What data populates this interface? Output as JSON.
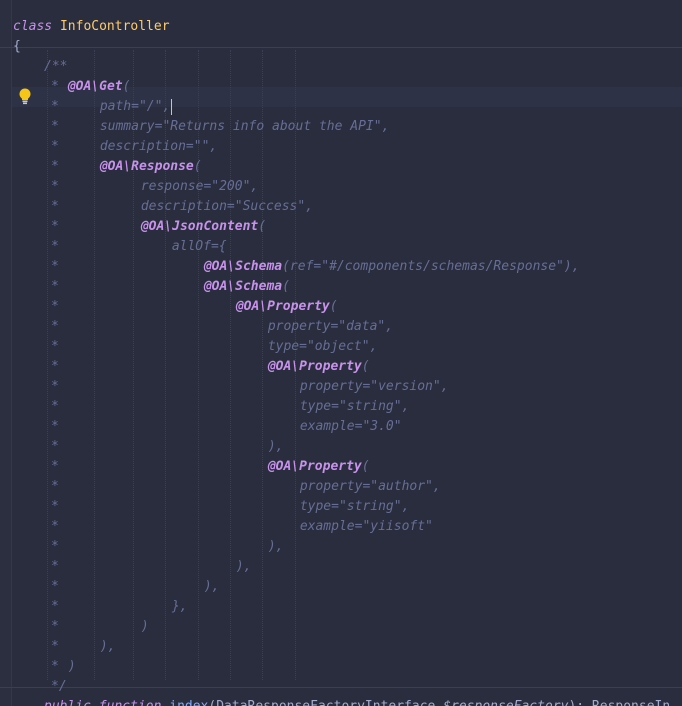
{
  "editor": {
    "header_lines": [
      {
        "kw": "class",
        "name": "InfoController"
      },
      {
        "brace": "{"
      }
    ],
    "doc_lines": [
      {
        "indent": 0,
        "text": "/**"
      },
      {
        "indent": 0,
        "star": "*",
        "ann": "@OA\\Get",
        "rest": "("
      },
      {
        "indent": 1,
        "star": "*",
        "rest": "path=\"/\","
      },
      {
        "indent": 1,
        "star": "*",
        "rest": "summary=\"Returns info about the API\","
      },
      {
        "indent": 1,
        "star": "*",
        "rest": "description=\"\","
      },
      {
        "indent": 1,
        "star": "*",
        "ann": "@OA\\Response",
        "rest": "("
      },
      {
        "indent": 2,
        "star": "*",
        "rest": "response=\"200\","
      },
      {
        "indent": 2,
        "star": "*",
        "rest": "description=\"Success\","
      },
      {
        "indent": 2,
        "star": "*",
        "ann": "@OA\\JsonContent",
        "rest": "("
      },
      {
        "indent": 3,
        "star": "*",
        "rest": "allOf={"
      },
      {
        "indent": 4,
        "star": "*",
        "ann": "@OA\\Schema",
        "rest": "(ref=\"#/components/schemas/Response\"),"
      },
      {
        "indent": 4,
        "star": "*",
        "ann": "@OA\\Schema",
        "rest": "("
      },
      {
        "indent": 5,
        "star": "*",
        "ann": "@OA\\Property",
        "rest": "("
      },
      {
        "indent": 6,
        "star": "*",
        "rest": "property=\"data\","
      },
      {
        "indent": 6,
        "star": "*",
        "rest": "type=\"object\","
      },
      {
        "indent": 6,
        "star": "*",
        "ann": "@OA\\Property",
        "rest": "("
      },
      {
        "indent": 7,
        "star": "*",
        "rest": "property=\"version\","
      },
      {
        "indent": 7,
        "star": "*",
        "rest": "type=\"string\","
      },
      {
        "indent": 7,
        "star": "*",
        "rest": "example=\"3.0\""
      },
      {
        "indent": 6,
        "star": "*",
        "rest": "),"
      },
      {
        "indent": 6,
        "star": "*",
        "ann": "@OA\\Property",
        "rest": "("
      },
      {
        "indent": 7,
        "star": "*",
        "rest": "property=\"author\","
      },
      {
        "indent": 7,
        "star": "*",
        "rest": "type=\"string\","
      },
      {
        "indent": 7,
        "star": "*",
        "rest": "example=\"yiisoft\""
      },
      {
        "indent": 6,
        "star": "*",
        "rest": "),"
      },
      {
        "indent": 5,
        "star": "*",
        "rest": "),"
      },
      {
        "indent": 4,
        "star": "*",
        "rest": "),"
      },
      {
        "indent": 3,
        "star": "*",
        "rest": "},"
      },
      {
        "indent": 2,
        "star": "*",
        "rest": ")"
      },
      {
        "indent": 1,
        "star": "*",
        "rest": "),"
      },
      {
        "indent": 0,
        "star": "*",
        "rest": ")"
      },
      {
        "indent": 0,
        "text": "*/"
      }
    ],
    "signature": {
      "kw1": "public",
      "kw2": "function",
      "fn": "index",
      "open": "(",
      "type": "DataResponseFactoryInterface",
      "var": "$responseFactory",
      "close": "): ",
      "ret": "ResponseIn"
    },
    "colors": {
      "background": "#292d3e",
      "comment": "#676e95",
      "annotation": "#c792ea",
      "class_name": "#ffcb6b",
      "function_name": "#82aaff",
      "caret": "#ffcc00",
      "bulb": "#f5c518"
    },
    "icons": {
      "bulb": "lightbulb-icon"
    }
  }
}
